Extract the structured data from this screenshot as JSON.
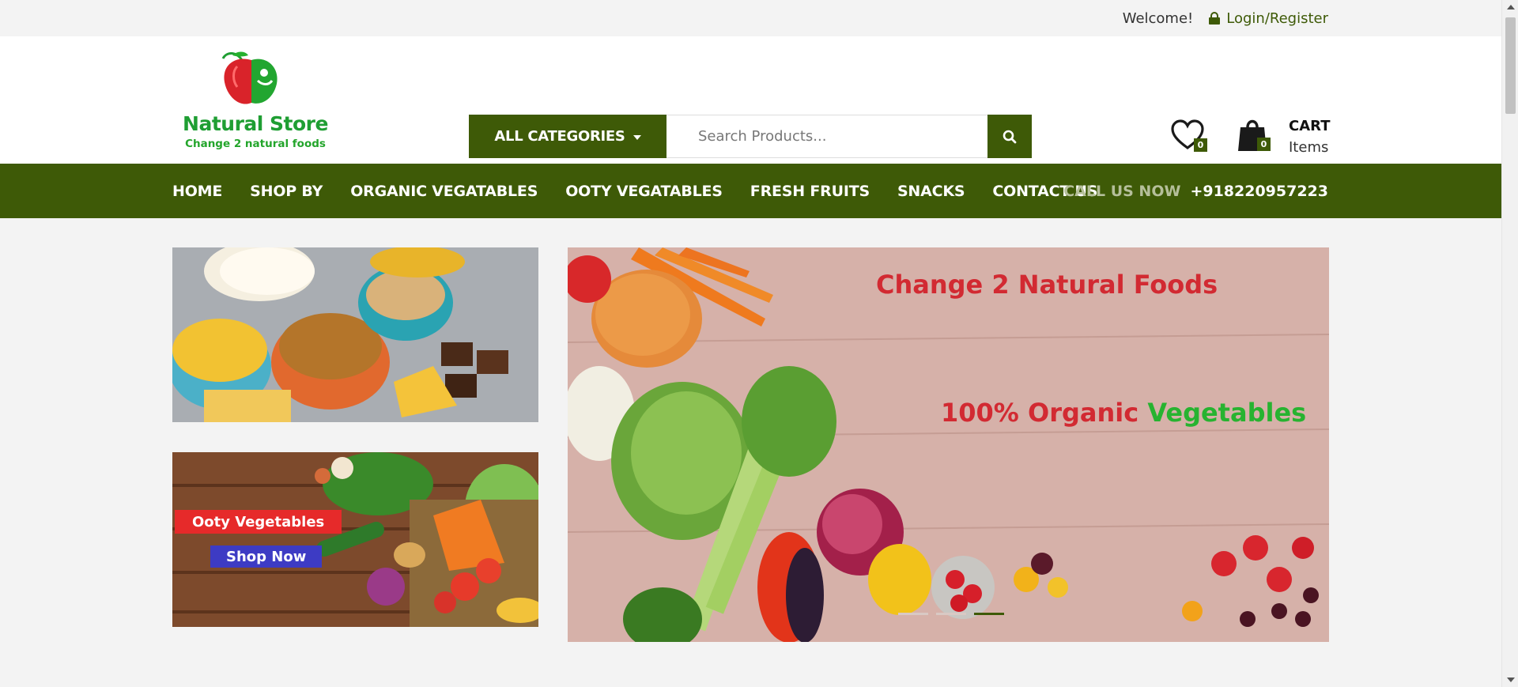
{
  "topbar": {
    "welcome": "Welcome!",
    "login": "Login/Register",
    "lock_icon": "lock-icon"
  },
  "logo": {
    "name": "Natural Store",
    "tagline": "Change 2 natural foods",
    "icon": "apple-logo-icon"
  },
  "search": {
    "category_label": "ALL CATEGORIES",
    "placeholder": "Search Products...",
    "button_icon": "search-icon"
  },
  "wishlist": {
    "count": "0",
    "icon": "heart-icon"
  },
  "cart": {
    "title": "CART",
    "subtitle": "Items",
    "count": "0",
    "icon": "shopping-bag-icon"
  },
  "nav": {
    "items": [
      {
        "label": "HOME"
      },
      {
        "label": "SHOP BY"
      },
      {
        "label": "ORGANIC VEGATABLES"
      },
      {
        "label": "OOTY VEGATABLES"
      },
      {
        "label": "FRESH FRUITS"
      },
      {
        "label": "SNACKS"
      },
      {
        "label": "CONTACT US"
      }
    ],
    "call_label": "CALL US NOW",
    "call_number": "+918220957223"
  },
  "banners": {
    "side2_tag": "Ooty Vegetables",
    "side2_button": "Shop Now"
  },
  "hero": {
    "line1": "Change 2 Natural Foods",
    "line2_red": "100% Organic",
    "line2_green": "Vegetables",
    "slides": 3,
    "active_slide": 3
  },
  "colors": {
    "brand_green": "#3e5a07",
    "hero_red": "#d22a32",
    "hero_green": "#27b330"
  }
}
